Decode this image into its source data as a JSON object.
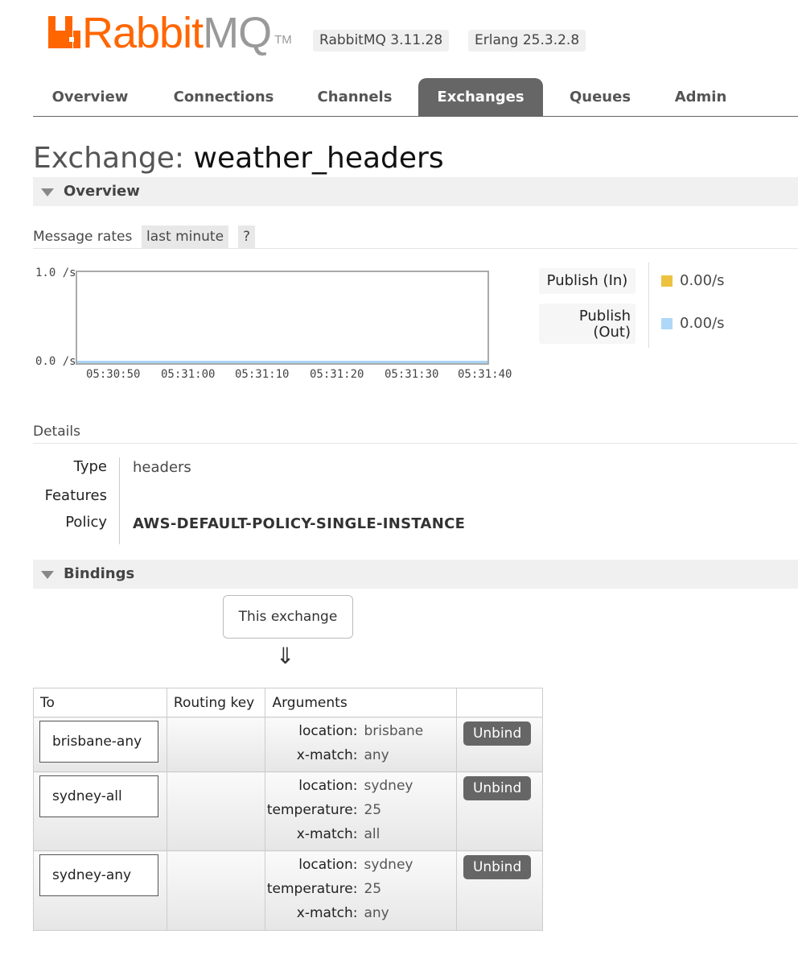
{
  "header": {
    "brand_prefix": "Rabbit",
    "brand_suffix": "MQ",
    "tm": "TM",
    "version_rabbit": "RabbitMQ 3.11.28",
    "version_erlang": "Erlang 25.3.2.8"
  },
  "tabs": [
    "Overview",
    "Connections",
    "Channels",
    "Exchanges",
    "Queues",
    "Admin"
  ],
  "active_tab": "Exchanges",
  "page": {
    "title_label": "Exchange:",
    "exchange_name": "weather_headers"
  },
  "overview": {
    "section_title": "Overview",
    "message_rates_label": "Message rates",
    "range": "last minute",
    "help": "?"
  },
  "chart_data": {
    "type": "line",
    "y_ticks": [
      "1.0 /s",
      "0.0 /s"
    ],
    "x_ticks": [
      "05:30:50",
      "05:31:00",
      "05:31:10",
      "05:31:20",
      "05:31:30",
      "05:31:40"
    ],
    "series": [
      {
        "name": "Publish (In)",
        "value": "0.00/s",
        "color": "#edc240"
      },
      {
        "name": "Publish (Out)",
        "value": "0.00/s",
        "color": "#afd8f8"
      }
    ],
    "legend": [
      "Publish (In)",
      "Publish",
      "(Out)"
    ]
  },
  "details": {
    "title": "Details",
    "rows": [
      {
        "key": "Type",
        "value": "headers"
      },
      {
        "key": "Features",
        "value": ""
      },
      {
        "key": "Policy",
        "value": "AWS-DEFAULT-POLICY-SINGLE-INSTANCE"
      }
    ]
  },
  "bindings": {
    "section_title": "Bindings",
    "this_exchange": "This exchange",
    "arrow": "⇓",
    "columns": [
      "To",
      "Routing key",
      "Arguments"
    ],
    "rows": [
      {
        "to": "brisbane-any",
        "routing_key": "",
        "args": [
          [
            "location:",
            "brisbane"
          ],
          [
            "x-match:",
            "any"
          ]
        ],
        "action": "Unbind"
      },
      {
        "to": "sydney-all",
        "routing_key": "",
        "args": [
          [
            "location:",
            "sydney"
          ],
          [
            "temperature:",
            "25"
          ],
          [
            "x-match:",
            "all"
          ]
        ],
        "action": "Unbind"
      },
      {
        "to": "sydney-any",
        "routing_key": "",
        "args": [
          [
            "location:",
            "sydney"
          ],
          [
            "temperature:",
            "25"
          ],
          [
            "x-match:",
            "any"
          ]
        ],
        "action": "Unbind"
      }
    ]
  }
}
